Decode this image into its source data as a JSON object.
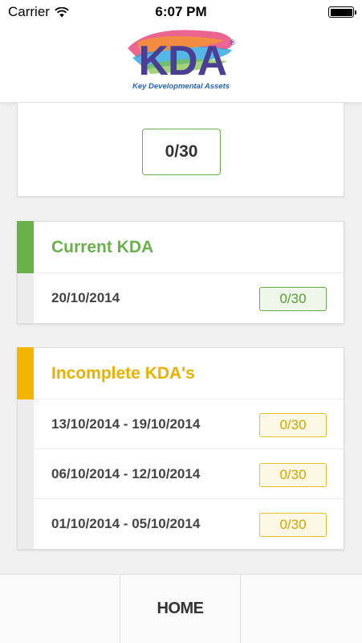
{
  "status_bar": {
    "carrier": "Carrier",
    "time": "6:07 PM"
  },
  "header": {
    "logo_text": "KDA",
    "logo_sub": "Key Developmental Assets",
    "logo_reg": "®",
    "colors": {
      "logo": "#4a3f95",
      "sub": "#2a63b8"
    }
  },
  "score": {
    "value": "0/30"
  },
  "current": {
    "title": "Current KDA",
    "accent_color": "#6ab04c",
    "rows": [
      {
        "date": "20/10/2014",
        "score": "0/30"
      }
    ]
  },
  "incomplete": {
    "title": "Incomplete KDA's",
    "accent_color": "#f4b400",
    "rows": [
      {
        "date": "13/10/2014 - 19/10/2014",
        "score": "0/30"
      },
      {
        "date": "06/10/2014 - 12/10/2014",
        "score": "0/30"
      },
      {
        "date": "01/10/2014 - 05/10/2014",
        "score": "0/30"
      }
    ]
  },
  "tabbar": {
    "home_label": "HOME"
  }
}
